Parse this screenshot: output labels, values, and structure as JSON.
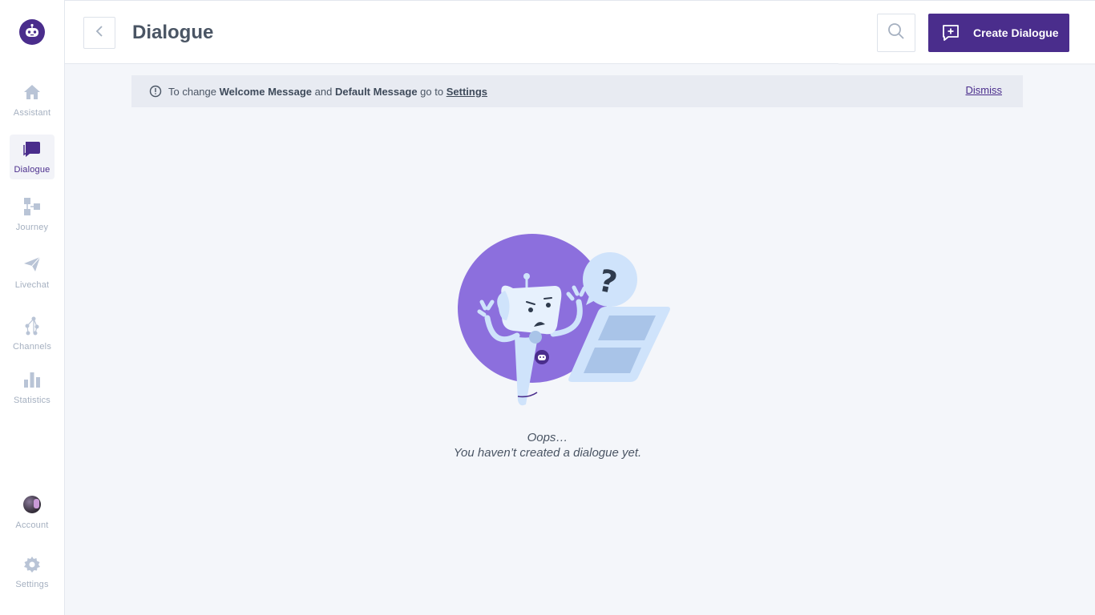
{
  "sidebar": {
    "items": [
      {
        "label": "Assistant",
        "icon": "home-icon"
      },
      {
        "label": "Dialogue",
        "icon": "chat-bubble-icon",
        "active": true
      },
      {
        "label": "Journey",
        "icon": "flow-icon"
      },
      {
        "label": "Livechat",
        "icon": "paper-plane-icon"
      },
      {
        "label": "Channels",
        "icon": "channels-icon"
      },
      {
        "label": "Statistics",
        "icon": "bar-chart-icon"
      }
    ],
    "account_label": "Account",
    "settings_label": "Settings"
  },
  "header": {
    "title": "Dialogue",
    "create_label": "Create Dialogue"
  },
  "notice": {
    "prefix": "To change",
    "welcome": "Welcome Message",
    "and": "and",
    "default": "Default Message",
    "goto": "go to",
    "link": "Settings",
    "dismiss": "Dismiss"
  },
  "empty": {
    "title": "Oops…",
    "subtitle": "You haven’t created a dialogue yet."
  },
  "colors": {
    "accent": "#4a2d8c",
    "sidebar_icon": "#b9c4d6",
    "purple_circle": "#8c6fdd",
    "robot_light": "#cfe3fb"
  }
}
